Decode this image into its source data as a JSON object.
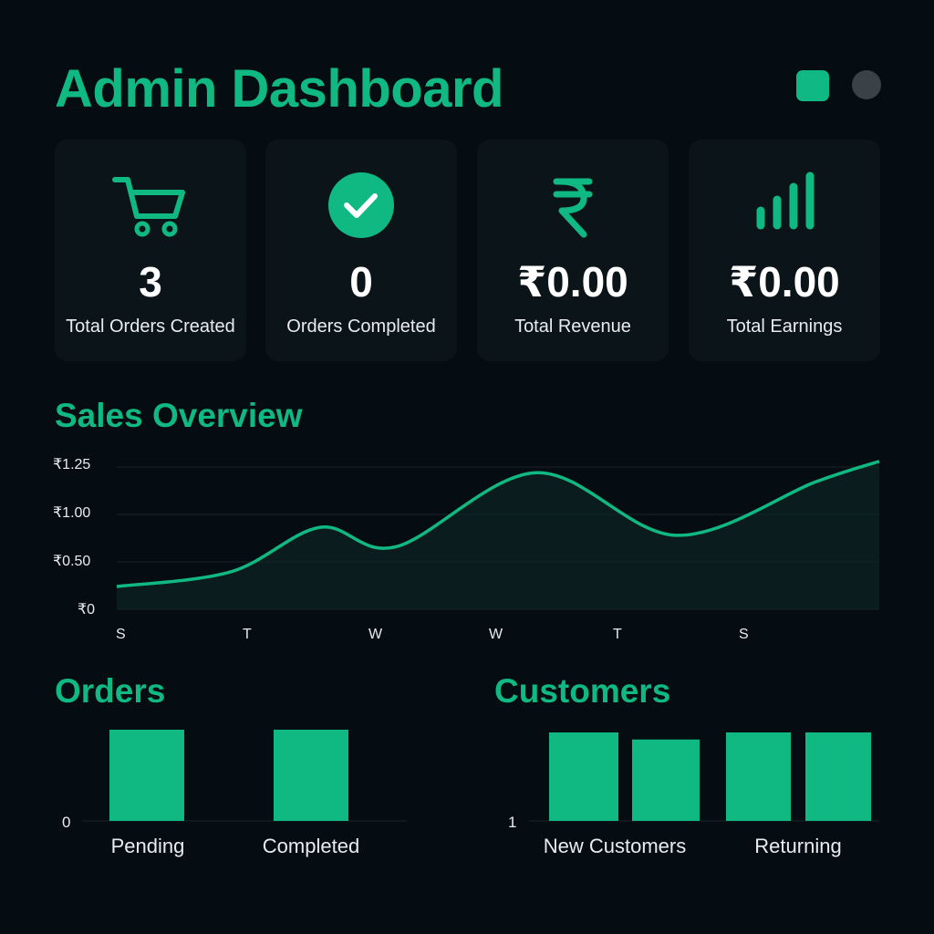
{
  "header": {
    "title": "Admin Dashboard"
  },
  "stats": [
    {
      "icon": "cart-icon",
      "value": "3",
      "label": "Total Orders Created"
    },
    {
      "icon": "check-circle-icon",
      "value": "0",
      "label": "Orders Completed"
    },
    {
      "icon": "rupee-icon",
      "value": "₹0.00",
      "label": "Total Revenue"
    },
    {
      "icon": "bar-signal-icon",
      "value": "₹0.00",
      "label": "Total Earnings"
    }
  ],
  "colors": {
    "accent": "#10b981",
    "background": "#050d12",
    "card": "#0b1419"
  },
  "sales": {
    "title": "Sales Overview"
  },
  "orders": {
    "title": "Orders"
  },
  "customers": {
    "title": "Customers"
  },
  "chart_data": [
    {
      "type": "line",
      "title": "Sales Overview",
      "x": [
        "S",
        "T",
        "W",
        "W",
        "T",
        "S"
      ],
      "y_ticks": [
        "₹1.25",
        "₹1.00",
        "₹0.50",
        "₹0"
      ],
      "ylim": [
        0,
        1.25
      ],
      "grid": true,
      "series": [
        {
          "values": [
            0.2,
            0.33,
            0.72,
            0.55,
            1.2,
            0.65,
            1.12,
            1.3
          ]
        }
      ],
      "points_x": [
        0,
        0.9,
        1.6,
        2.2,
        3.3,
        4.4,
        5.5,
        6.0
      ]
    },
    {
      "type": "bar",
      "title": "Orders",
      "categories": [
        "Pending",
        "Completed"
      ],
      "values": [
        1,
        1
      ],
      "y_ticks": [
        "0"
      ],
      "ylim": [
        0,
        1
      ]
    },
    {
      "type": "bar",
      "title": "Customers",
      "categories": [
        "New Customers",
        "Returning"
      ],
      "series_values": [
        [
          1,
          0.92
        ],
        [
          1,
          1
        ]
      ],
      "y_ticks": [
        "1"
      ],
      "ylim": [
        0,
        1
      ]
    }
  ]
}
